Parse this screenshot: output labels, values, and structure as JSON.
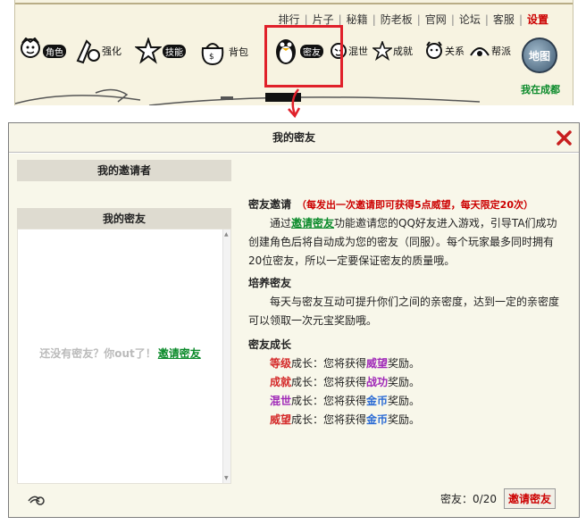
{
  "topnav": {
    "items": [
      "排行",
      "片子",
      "秘籍",
      "防老板",
      "官网",
      "论坛",
      "客服"
    ],
    "settings": "设置"
  },
  "game_icons": [
    {
      "label": "角色",
      "icon": "character-icon"
    },
    {
      "label": "强化",
      "icon": "enhance-icon"
    },
    {
      "label": "技能",
      "icon": "skill-icon"
    },
    {
      "label": "背包",
      "icon": "bag-icon"
    },
    {
      "label": "密友",
      "icon": "qq-penguin-icon"
    },
    {
      "label": "混世",
      "icon": "hunshi-icon"
    },
    {
      "label": "成就",
      "icon": "star-icon"
    },
    {
      "label": "关系",
      "icon": "relation-icon"
    },
    {
      "label": "帮派",
      "icon": "gang-icon"
    }
  ],
  "map": {
    "label": "地图",
    "location": "我在成都"
  },
  "dialog": {
    "title": "我的密友",
    "inviters_header": "我的邀请者",
    "friends_header": "我的密友",
    "empty_text": "还没有密友？你out了！",
    "empty_link": "邀请密友",
    "invite_title": "密友邀请",
    "invite_note": "（每发出一次邀请即可获得5点威望，每天限定20次）",
    "invite_pre": "通过",
    "invite_link": "邀请密友",
    "invite_post": "功能邀请您的QQ好友进入游戏，引导TA们成功创建角色后将自动成为您的密友（同服）。每个玩家最多同时拥有20位密友，所以一定要保证密友的质量哦。",
    "cultivate_title": "培养密友",
    "cultivate_text": "每天与密友互动可提升你们之间的亲密度，达到一定的亲密度可以领取一次元宝奖励哦。",
    "growth_title": "密友成长",
    "growth": [
      {
        "key": "等级",
        "mid": "成长：您将获得",
        "reward": "威望",
        "end": "奖励。"
      },
      {
        "key": "成就",
        "mid": "成长：您将获得",
        "reward": "战功",
        "end": "奖励。"
      },
      {
        "key": "混世",
        "mid": "成长：您将获得",
        "reward": "金币",
        "end": "奖励。"
      },
      {
        "key": "威望",
        "mid": "成长：您将获得",
        "reward": "金币",
        "end": "奖励。"
      }
    ],
    "count_label": "密友：0/20",
    "invite_button": "邀请密友"
  },
  "colors": {
    "highlight_box": "#e0202a",
    "accent_green": "#0a8a2a",
    "accent_red": "#c00"
  }
}
